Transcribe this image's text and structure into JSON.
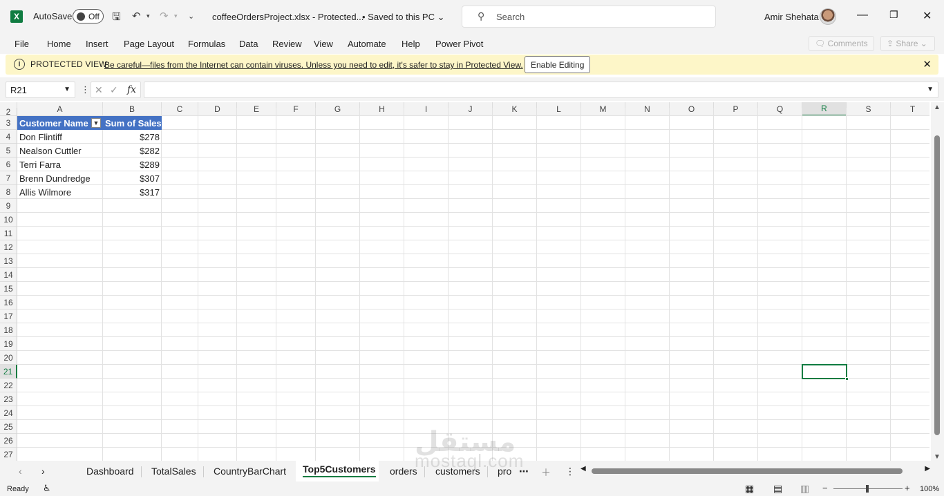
{
  "titlebar": {
    "autosave_label": "AutoSave",
    "autosave_state": "Off",
    "filename": "coffeeOrdersProject.xlsx  -  Protected...",
    "saved_status": "• Saved to this PC",
    "search_placeholder": "Search",
    "user_name": "Amir Shehata"
  },
  "menu": {
    "items": [
      "File",
      "Home",
      "Insert",
      "Page Layout",
      "Formulas",
      "Data",
      "Review",
      "View",
      "Automate",
      "Help",
      "Power Pivot"
    ],
    "comments_label": "Comments",
    "share_label": "Share"
  },
  "protected_view": {
    "title": "PROTECTED VIEW",
    "message": "Be careful—files from the Internet can contain viruses. Unless you need to edit, it's safer to stay in Protected View.",
    "enable_button": "Enable Editing"
  },
  "formula_bar": {
    "name_box": "R21",
    "fx": "fx",
    "formula": ""
  },
  "grid": {
    "columns": [
      "A",
      "B",
      "C",
      "D",
      "E",
      "F",
      "G",
      "H",
      "I",
      "J",
      "K",
      "L",
      "M",
      "N",
      "O",
      "P",
      "Q",
      "R",
      "S",
      "T"
    ],
    "rows": [
      "2",
      "3",
      "4",
      "5",
      "6",
      "7",
      "8",
      "9",
      "10",
      "11",
      "12",
      "13",
      "14",
      "15",
      "16",
      "17",
      "18",
      "19",
      "20",
      "21",
      "22",
      "23",
      "24",
      "25",
      "26",
      "27"
    ],
    "selected_cell": "R21"
  },
  "pivot": {
    "header_name": "Customer Name",
    "header_sales": "Sum of Sales",
    "rows": [
      {
        "name": "Don Flintiff",
        "sales": "$278"
      },
      {
        "name": "Nealson Cuttler",
        "sales": "$282"
      },
      {
        "name": "Terri Farra",
        "sales": "$289"
      },
      {
        "name": "Brenn Dundredge",
        "sales": "$307"
      },
      {
        "name": "Allis Wilmore",
        "sales": "$317"
      }
    ]
  },
  "sheets": {
    "tabs": [
      "Dashboard",
      "TotalSales",
      "CountryBarChart",
      "Top5Customers",
      "orders",
      "customers",
      "pro"
    ],
    "active": "Top5Customers"
  },
  "status": {
    "ready": "Ready",
    "zoom": "100%"
  },
  "watermark": {
    "arabic": "مستقل",
    "latin": "mostaql.com"
  },
  "colors": {
    "accent": "#107c41",
    "pivot_header": "#4472c4",
    "protected_bar": "#fdf6c8"
  }
}
